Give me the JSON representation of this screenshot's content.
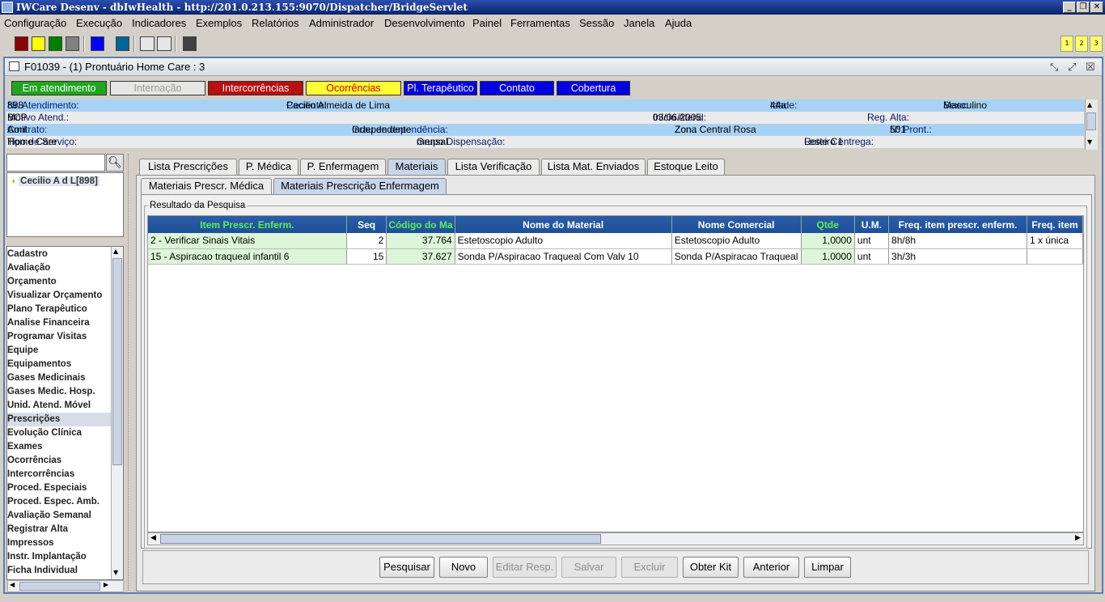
{
  "window": {
    "title": "IWCare Desenv - dbIwHealth - http://201.0.213.155:9070/Dispatcher/BridgeServlet"
  },
  "menu": [
    "Configuração",
    "Execução",
    "Indicadores",
    "Exemplos",
    "Relatórios",
    "Administrador",
    "Desenvolvimento",
    "Painel",
    "Ferramentas",
    "Sessão",
    "Janela",
    "Ajuda"
  ],
  "toolbar": {
    "colors": [
      "#8b0000",
      "#ffff00",
      "#008000",
      "#808080",
      "#0000ff",
      "#006699",
      "#404040"
    ],
    "right_buttons": [
      "1",
      "2",
      "3"
    ]
  },
  "frame": {
    "title": "F01039 - (1) Prontuário Home Care : 3"
  },
  "status_buttons": [
    {
      "label": "Em atendimento",
      "bg": "#1fa51f",
      "fg": "#ffffff"
    },
    {
      "label": "Internação",
      "bg": "#e6e6e6",
      "fg": "#9a9a9a"
    },
    {
      "label": "Intercorrências",
      "bg": "#b80f0f",
      "fg": "#ffffff"
    },
    {
      "label": "Ocorrências",
      "bg": "#ffff33",
      "fg": "#d00000"
    },
    {
      "label": "Pl. Terapêutico",
      "bg": "#0000e0",
      "fg": "#ffffff"
    },
    {
      "label": "Contato",
      "bg": "#0000e0",
      "fg": "#ffffff"
    },
    {
      "label": "Cobertura",
      "bg": "#0000e0",
      "fg": "#ffffff"
    }
  ],
  "info": {
    "nr_atendimento_label": "Nr. Atendimento:",
    "nr_atendimento": "898",
    "paciente_label": "Paciente:",
    "paciente": "Cecilio Almeida de Lima",
    "idade_label": "Idade:",
    "idade": "44a",
    "sexo_label": "Sexo:",
    "sexo": "Masculino",
    "motivo_label": "Motivo Atend.:",
    "motivo": "BCP",
    "inicio_label": "Início Atend:",
    "inicio": "03/06/2005",
    "reg_alta_label": "Reg. Alta:",
    "contrato_label": "Contrato:",
    "contrato": "Amil",
    "grau_label": "Grau de dependência:",
    "grau": "Independente",
    "zona_label": "Zon.:",
    "zona": "Zona Central Rosa",
    "pront_label": "Nº Pront.:",
    "pront": "501",
    "tipo_label": "Tipo de Serviço:",
    "tipo": "Home Care",
    "grupo_label": "Grupo Dispensação:",
    "grupo": "mensal",
    "roteiro_label": "Roteiro entrega:",
    "roteiro": "Leste C1"
  },
  "patient_list": {
    "item": "Cecilio A d L[898]"
  },
  "nav": [
    "Cadastro",
    "Avaliação",
    "Orçamento",
    "Visualizar Orçamento",
    "Plano Terapêutico",
    "Analise Financeira",
    "Programar Visitas",
    "Equipe",
    "Equipamentos",
    "Gases Medicinais",
    "Gases Medic. Hosp.",
    "Unid. Atend. Móvel",
    "Prescrições",
    "Evolução Clínica",
    "Exames",
    "Ocorrências",
    "Intercorrências",
    "Proced. Especiais",
    "Proced. Espec. Amb.",
    "Avaliação Semanal",
    "Registrar Alta",
    "Impressos",
    "Instr. Implantação",
    "Ficha Individual"
  ],
  "nav_selected": "Prescrições",
  "tabs": [
    "Lista Prescrições",
    "P. Médica",
    "P. Enfermagem",
    "Materiais",
    "Lista Verificação",
    "Lista Mat. Enviados",
    "Estoque Leito"
  ],
  "active_tab": "Materiais",
  "subtabs": [
    "Materiais Prescr. Médica",
    "Materiais Prescrição Enfermagem"
  ],
  "active_subtab": "Materiais Prescrição Enfermagem",
  "group_label": "Resultado da Pesquisa",
  "table": {
    "columns": [
      "Item Prescr. Enferm.",
      "Seq",
      "Código do Ma",
      "Nome do Material",
      "Nome Comercial",
      "Qtde",
      "U.M.",
      "Freq. item prescr. enferm.",
      "Freq. item"
    ],
    "rows": [
      [
        "2 - Verificar Sinais Vitais",
        "2",
        "37.764",
        "Estetoscopio Adulto",
        "Estetoscopio Adulto",
        "1,0000",
        "unt",
        "8h/8h",
        "1 x única"
      ],
      [
        "15 - Aspiracao traqueal infantil 6",
        "15",
        "37.627",
        "Sonda P/Aspiracao Traqueal Com Valv 10",
        "Sonda P/Aspiracao Traqueal",
        "1,0000",
        "unt",
        "3h/3h",
        ""
      ]
    ]
  },
  "buttons": {
    "pesquisar": "Pesquisar",
    "novo": "Novo",
    "editar": "Editar Resp.",
    "salvar": "Salvar",
    "excluir": "Excluir",
    "obter_kit": "Obter Kit",
    "anterior": "Anterior",
    "limpar": "Limpar"
  }
}
